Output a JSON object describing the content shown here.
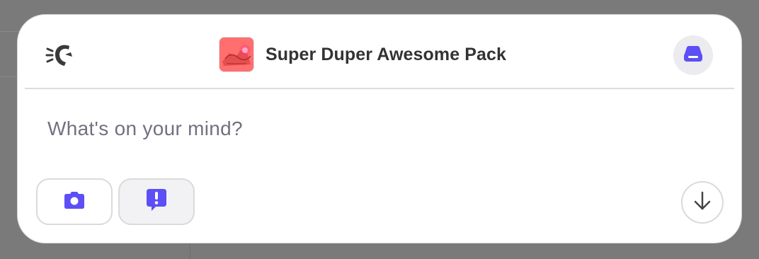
{
  "header": {
    "back_icon": "speed-back-icon",
    "pack_thumbnail_icon": "pack-thumbnail",
    "title": "Super Duper Awesome Pack",
    "drive_icon": "drive-icon"
  },
  "composer": {
    "placeholder": "What's on your mind?"
  },
  "toolbar": {
    "camera_icon": "camera-icon",
    "report_icon": "report-icon",
    "scroll_icon": "arrow-down-icon"
  },
  "colors": {
    "accent": "#5b4ff5",
    "icon_dark": "#3a3a3a",
    "placeholder": "#727181",
    "thumb_red": "#ff6b6b"
  }
}
